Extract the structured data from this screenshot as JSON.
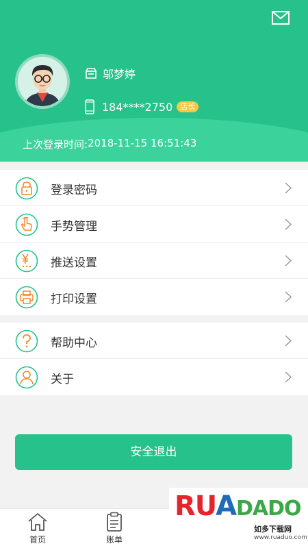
{
  "header": {
    "user_name": "邬梦婷",
    "phone": "184****2750",
    "role_badge": "店长",
    "last_login_label": "上次登录时间:",
    "last_login_time": "2018-11-15 16:51:43"
  },
  "menu_group_1": [
    {
      "label": "登录密码",
      "icon": "lock-icon"
    },
    {
      "label": "手势管理",
      "icon": "gesture-hand-icon"
    },
    {
      "label": "推送设置",
      "icon": "yen-push-icon"
    },
    {
      "label": "打印设置",
      "icon": "printer-icon"
    }
  ],
  "menu_group_2": [
    {
      "label": "帮助中心",
      "icon": "help-question-icon"
    },
    {
      "label": "关于",
      "icon": "user-about-icon"
    }
  ],
  "logout_label": "安全退出",
  "tabbar": {
    "home_label": "首页",
    "bill_label": "账单"
  },
  "watermark": {
    "brand": "RUANDADO",
    "subtitle": "如多下载网",
    "url": "www.ruaduo.com"
  },
  "colors": {
    "primary": "#27c28c",
    "icon_orange": "#f08a2c",
    "badge": "#f7c843"
  }
}
